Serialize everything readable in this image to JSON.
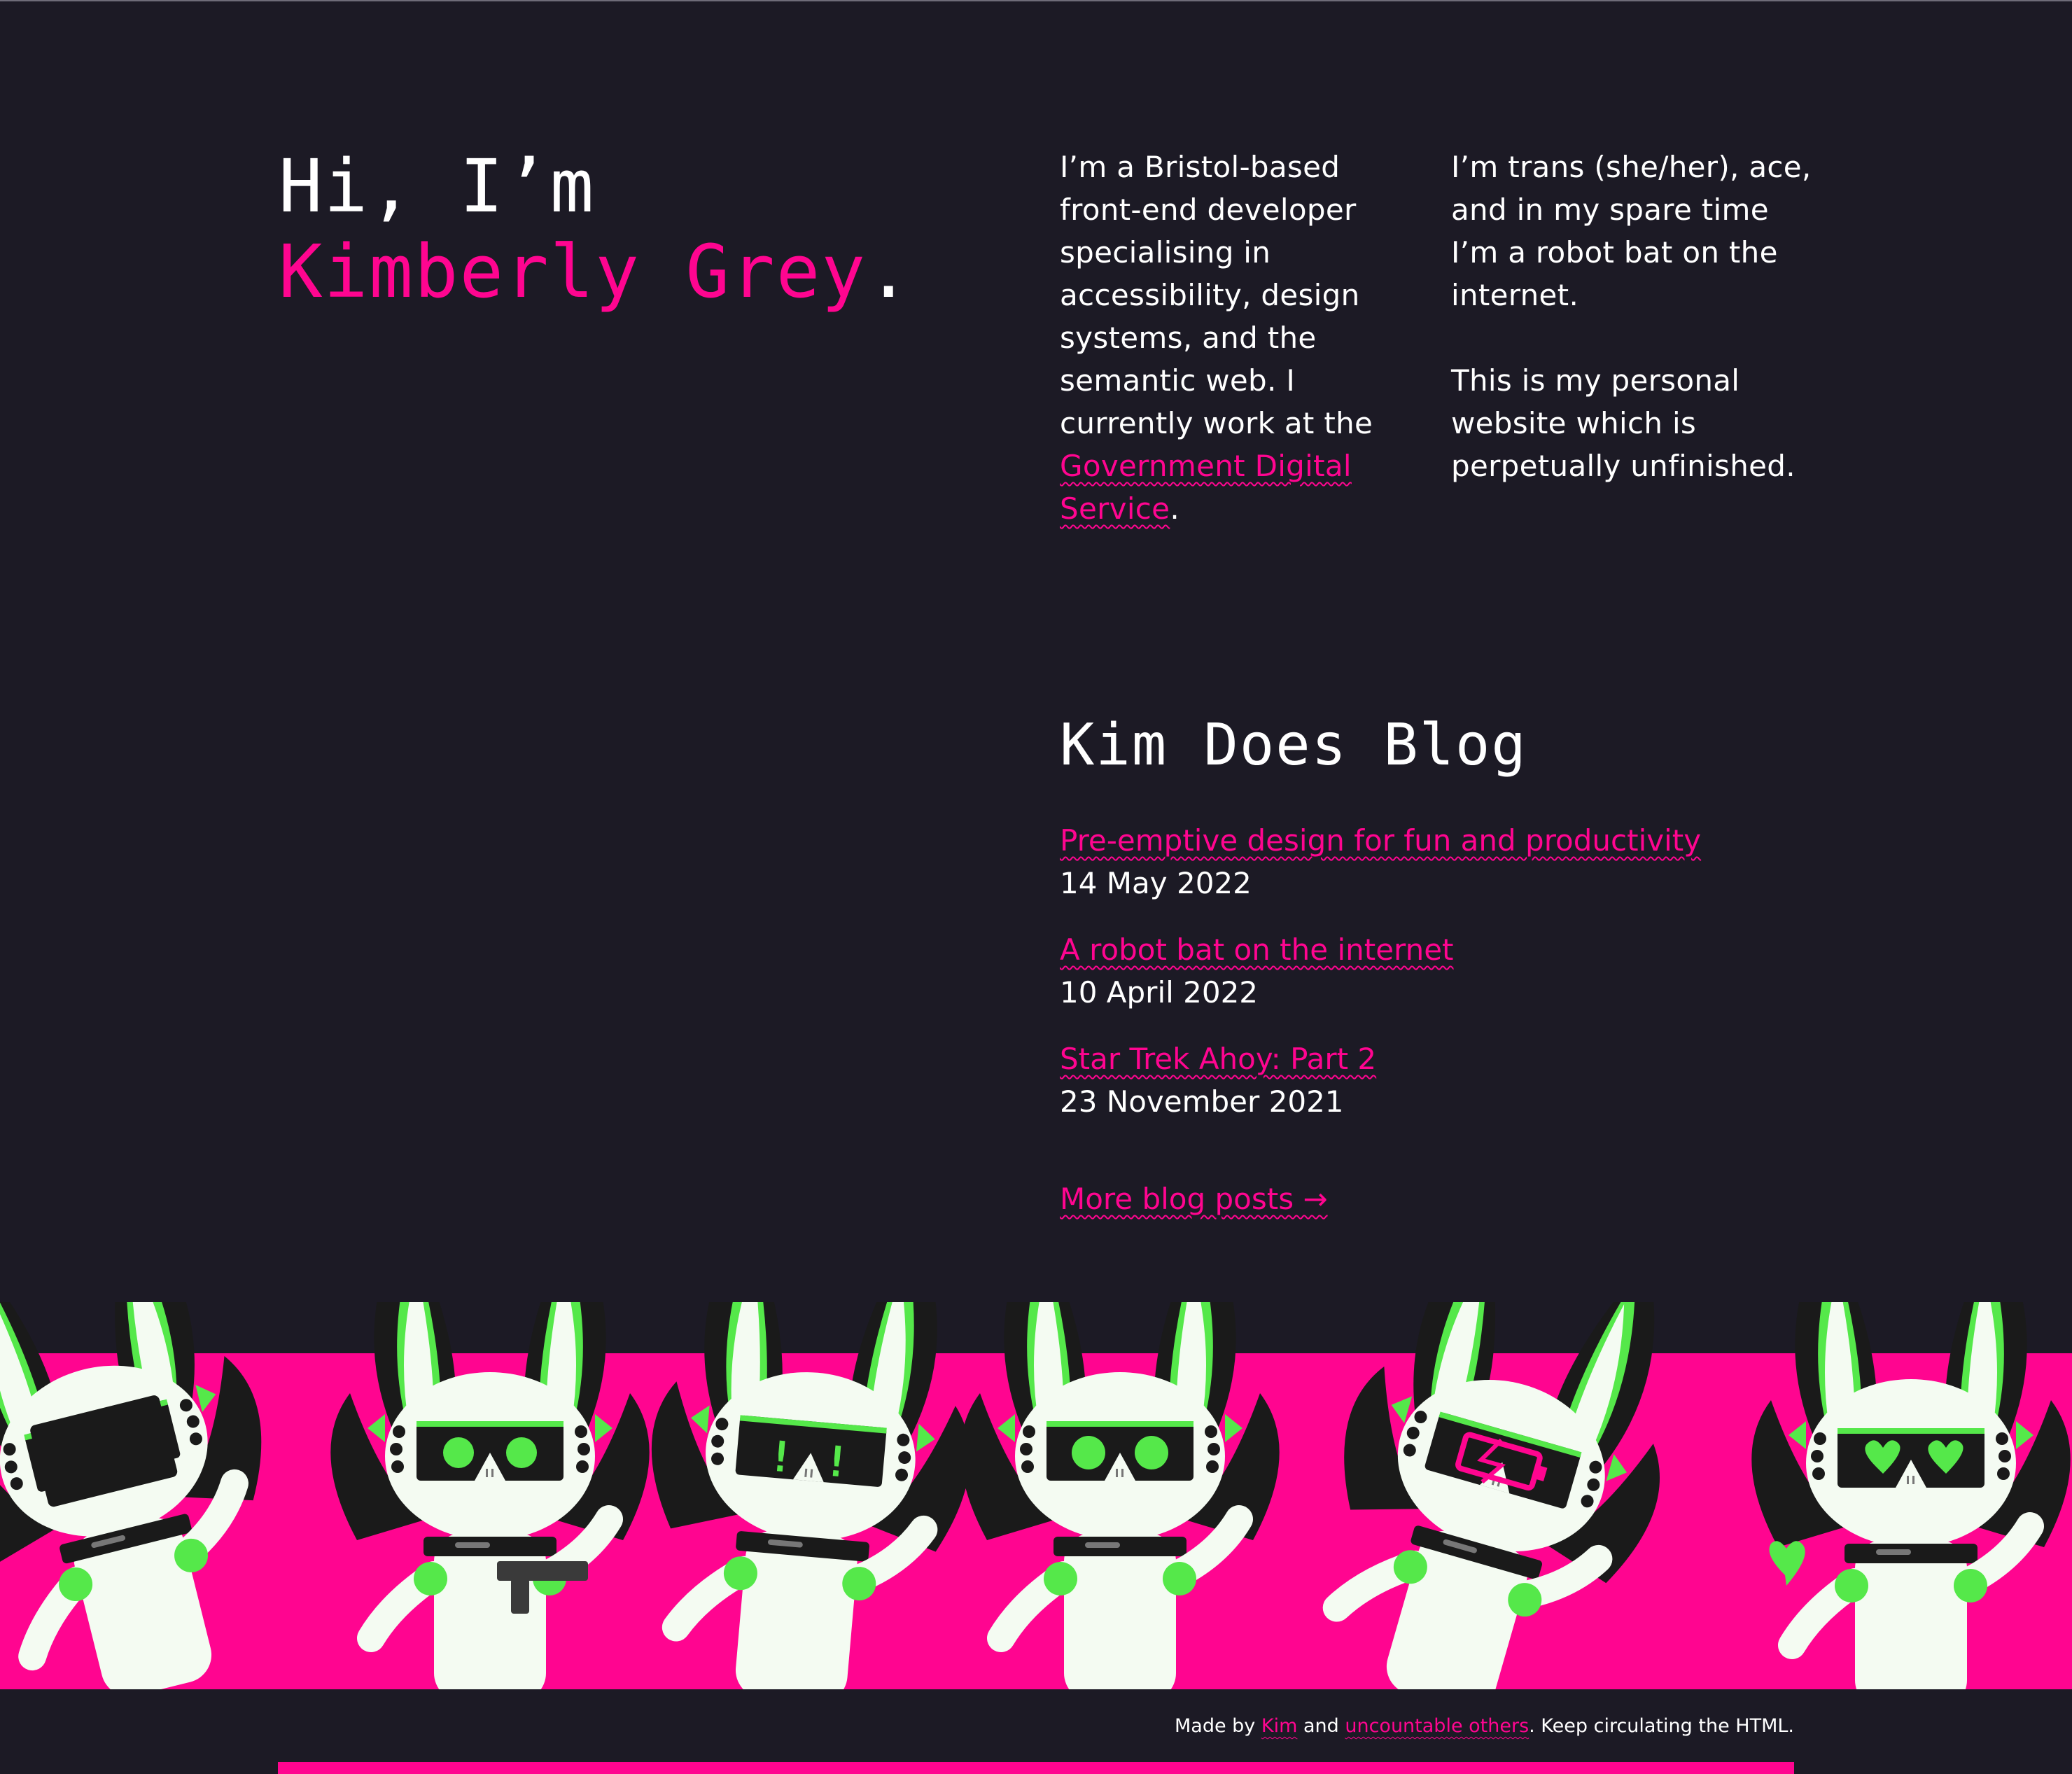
{
  "colors": {
    "background": "#1c1a25",
    "accent": "#ff0590",
    "green": "#55e84a",
    "white": "#f4fbf2",
    "ink": "#1a1a1a"
  },
  "hero": {
    "greeting": "Hi, I’m",
    "name": "Kimberly Grey",
    "punctuation": "."
  },
  "intro": {
    "left_text": "I’m a Bristol-based front-end developer specialising in accessibility, design systems, and the semantic web. I currently work at the ",
    "left_link": "Government Digital Service",
    "left_after": ".",
    "right_p1": "I’m trans (she/her), ace, and in my spare time I’m a robot bat on the internet.",
    "right_p2": "This is my personal website which is perpetually unfinished."
  },
  "blog": {
    "heading": "Kim Does Blog",
    "posts": [
      {
        "title": "Pre-emptive design for fun and productivity",
        "date": "14 May 2022"
      },
      {
        "title": "A robot bat on the internet",
        "date": "10 April 2022"
      },
      {
        "title": "Star Trek Ahoy: Part 2",
        "date": "23 November 2021"
      }
    ],
    "more_label": "More blog posts →"
  },
  "banner": {
    "icons": [
      "robot-bat-dab-icon",
      "robot-bat-gun-icon",
      "robot-bat-exclaim-icon",
      "robot-bat-wave-icon",
      "robot-bat-battery-icon",
      "robot-bat-heart-icon"
    ]
  },
  "footer": {
    "made_by": "Made by ",
    "kim_link": "Kim",
    "and": " and ",
    "others_link": "uncountable others",
    "tail": ". Keep circulating the HTML."
  }
}
